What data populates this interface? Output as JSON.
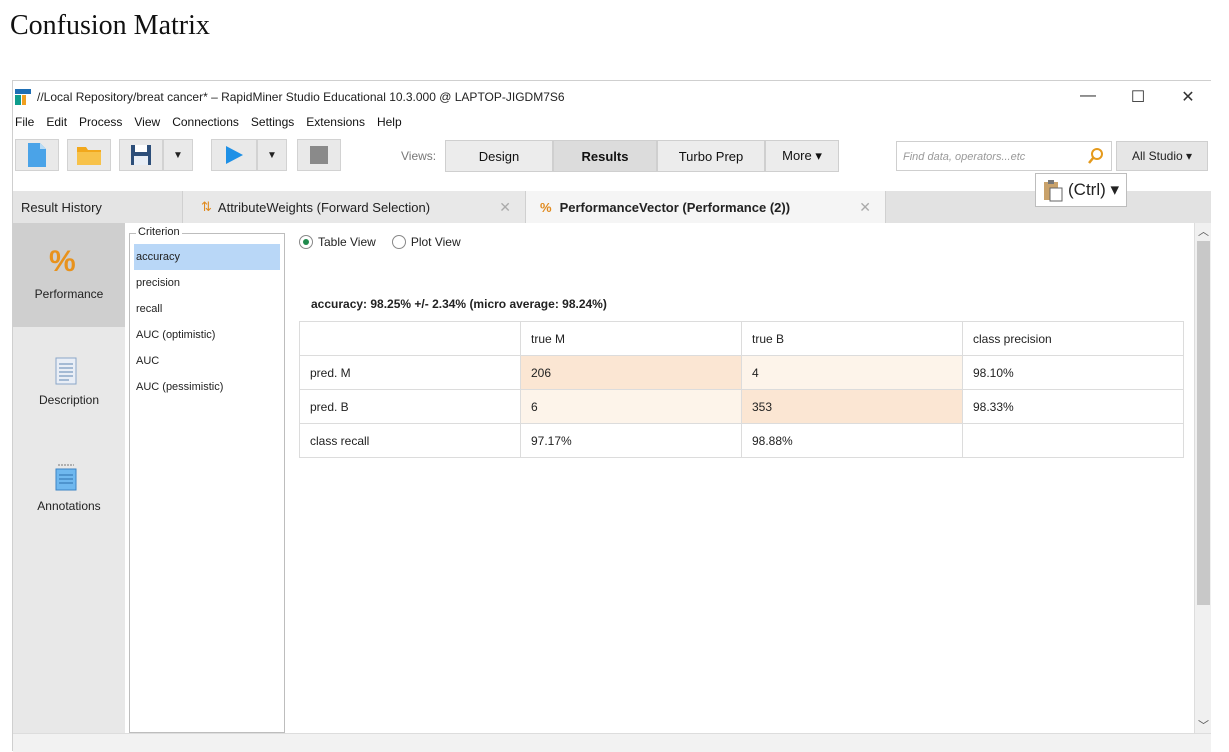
{
  "doc_title": "Confusion Matrix",
  "window": {
    "title": "//Local Repository/breat cancer* – RapidMiner Studio Educational 10.3.000 @ LAPTOP-JIGDM7S6",
    "controls": {
      "minimize": "—",
      "maximize": "☐",
      "close": "✕"
    }
  },
  "menu": [
    "File",
    "Edit",
    "Process",
    "View",
    "Connections",
    "Settings",
    "Extensions",
    "Help"
  ],
  "toolbar": {
    "views_label": "Views:",
    "views": [
      "Design",
      "Results",
      "Turbo Prep",
      "More ▾"
    ],
    "active_view": "Results",
    "search_placeholder": "Find data, operators...etc",
    "all_studio": "All Studio ▾",
    "paste_tooltip": "(Ctrl) ▾"
  },
  "tabs": {
    "result_history": "Result History",
    "attribute_weights": "AttributeWeights (Forward Selection)",
    "performance_vector": "PerformanceVector (Performance (2))",
    "close_glyph": "✕"
  },
  "leftnav": [
    {
      "label": "Performance",
      "icon": "percent-icon"
    },
    {
      "label": "Description",
      "icon": "document-icon"
    },
    {
      "label": "Annotations",
      "icon": "annotation-icon"
    }
  ],
  "criterion": {
    "legend": "Criterion",
    "items": [
      "accuracy",
      "precision",
      "recall",
      "AUC (optimistic)",
      "AUC",
      "AUC (pessimistic)"
    ],
    "selected": "accuracy"
  },
  "view_options": {
    "table_view": "Table View",
    "plot_view": "Plot View",
    "selected": "Table View"
  },
  "accuracy_line": "accuracy: 98.25% +/- 2.34% (micro average: 98.24%)",
  "confusion_matrix": {
    "headers": [
      "",
      "true M",
      "true B",
      "class precision"
    ],
    "rows": [
      [
        "pred. M",
        "206",
        "4",
        "98.10%"
      ],
      [
        "pred. B",
        "6",
        "353",
        "98.33%"
      ],
      [
        "class recall",
        "97.17%",
        "98.88%",
        ""
      ]
    ]
  },
  "colors": {
    "selected_item": "#b9d7f7",
    "diagonal_cell": "#fbe6d3",
    "offdiag_cell": "#fdf4ea",
    "play_blue": "#1e90e6",
    "save_icon": "#2d4f7a"
  }
}
